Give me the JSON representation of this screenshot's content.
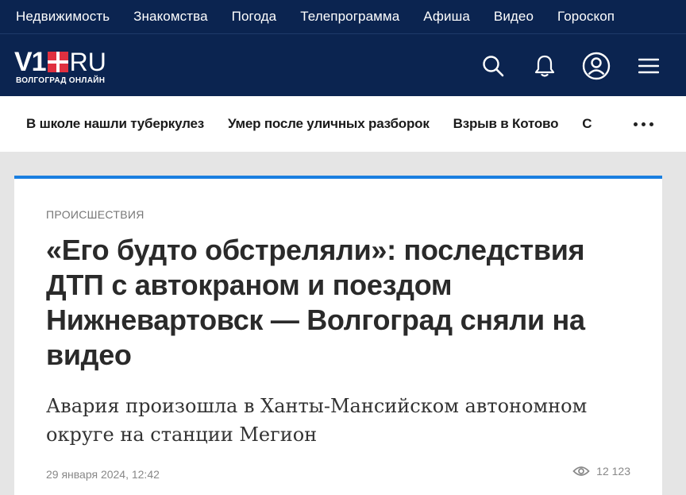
{
  "topnav": {
    "items": [
      "Недвижимость",
      "Знакомства",
      "Погода",
      "Телепрограмма",
      "Афиша",
      "Видео",
      "Гороскоп"
    ]
  },
  "header": {
    "logo_main": "V1",
    "logo_ru": "RU",
    "logo_sub": "ВОЛГОГРАД ОНЛАЙН",
    "icons": [
      "search-icon",
      "bell-icon",
      "user-icon",
      "menu-icon"
    ]
  },
  "trending": {
    "items": [
      "В школе нашли туберкулез",
      "Умер после уличных разборок",
      "Взрыв в Котово",
      "С"
    ]
  },
  "article": {
    "rubric": "ПРОИСШЕСТВИЯ",
    "title": "«Его будто обстреляли»: последствия ДТП с автокраном и поездом Нижневартовск — Волгоград сняли на видео",
    "lead": "Авария произошла в Ханты-Мансийском автономном округе на станции Мегион",
    "date": "29 января 2024, 12:42",
    "views": "12 123"
  },
  "colors": {
    "nav_bg": "#0b2450",
    "accent_blue": "#1a7fe0",
    "logo_red": "#e03040"
  }
}
